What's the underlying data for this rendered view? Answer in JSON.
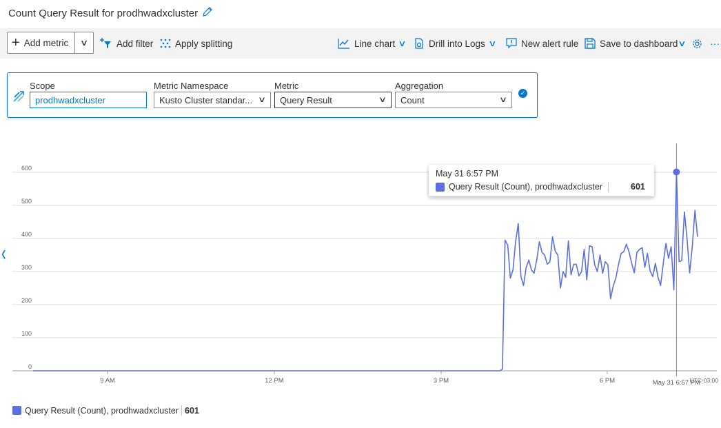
{
  "title": "Count Query Result for prodhwadxcluster",
  "toolbar": {
    "add_metric": "Add metric",
    "add_filter": "Add filter",
    "apply_splitting": "Apply splitting",
    "line_chart": "Line chart",
    "drill_into_logs": "Drill into Logs",
    "new_alert_rule": "New alert rule",
    "save_to_dashboard": "Save to dashboard",
    "more": "···"
  },
  "metric_panel": {
    "scope_label": "Scope",
    "scope_value": "prodhwadxcluster",
    "namespace_label": "Metric Namespace",
    "namespace_value": "Kusto Cluster standar...",
    "metric_label": "Metric",
    "metric_value": "Query Result",
    "aggregation_label": "Aggregation",
    "aggregation_value": "Count"
  },
  "tooltip": {
    "time": "May 31 6:57 PM",
    "series": "Query Result (Count), prodhwadxcluster",
    "value": "601"
  },
  "legend": {
    "series": "Query Result (Count), prodhwadxcluster",
    "value": "601"
  },
  "colors": {
    "accent": "#0078d4",
    "series": "#5b6fe0"
  },
  "chart_data": {
    "type": "line",
    "ylim": [
      0,
      600
    ],
    "yticks": [
      "0",
      "100",
      "200",
      "300",
      "400",
      "500",
      "600"
    ],
    "xticks": [
      "9 AM",
      "12 PM",
      "3 PM",
      "6 PM"
    ],
    "cursor_label": "May 31 6:57 PM",
    "timezone": "UTC-03:00",
    "series": [
      {
        "name": "Query Result (Count), prodhwadxcluster",
        "values": [
          0,
          0,
          0,
          0,
          0,
          0,
          0,
          0,
          0,
          0,
          0,
          0,
          0,
          0,
          0,
          0,
          0,
          0,
          0,
          0,
          0,
          0,
          0,
          0,
          0,
          0,
          0,
          0,
          0,
          0,
          0,
          0,
          0,
          0,
          0,
          0,
          0,
          0,
          0,
          0,
          0,
          0,
          0,
          0,
          0,
          0,
          0,
          0,
          0,
          0,
          0,
          0,
          0,
          0,
          0,
          0,
          0,
          0,
          0,
          0,
          0,
          0,
          0,
          0,
          0,
          0,
          0,
          0,
          0,
          0,
          0,
          0,
          0,
          0,
          0,
          0,
          0,
          0,
          0,
          0,
          0,
          0,
          0,
          0,
          0,
          0,
          0,
          0,
          0,
          0,
          0,
          0,
          0,
          0,
          0,
          0,
          0,
          0,
          0,
          0,
          0,
          0,
          0,
          0,
          0,
          0,
          0,
          0,
          0,
          0,
          0,
          0,
          0,
          0,
          0,
          0,
          0,
          0,
          0,
          0,
          0,
          0,
          0,
          0,
          0,
          0,
          0,
          0,
          0,
          0,
          0,
          0,
          0,
          0,
          0,
          0,
          0,
          0,
          0,
          0,
          0,
          0,
          0,
          0,
          0,
          0,
          0,
          0,
          0,
          0,
          0,
          0,
          0,
          0,
          0,
          0,
          0,
          0,
          0,
          0,
          0,
          0,
          0,
          0,
          0,
          0,
          0,
          0,
          0,
          0,
          0,
          0,
          0,
          0,
          0,
          0,
          0,
          0,
          5,
          395,
          380,
          280,
          305,
          390,
          445,
          285,
          258,
          312,
          335,
          305,
          295,
          335,
          390,
          358,
          350,
          322,
          330,
          405,
          362,
          350,
          250,
          300,
          282,
          393,
          290,
          322,
          322,
          287,
          300,
          367,
          275,
          378,
          375,
          320,
          300,
          350,
          295,
          330,
          320,
          218,
          256,
          280,
          320,
          355,
          360,
          383,
          360,
          325,
          296,
          358,
          367,
          372,
          313,
          355,
          302,
          285,
          325,
          283,
          258,
          326,
          385,
          340,
          375,
          245,
          601,
          330,
          333,
          480,
          400,
          296,
          375,
          485,
          405
        ]
      }
    ]
  }
}
